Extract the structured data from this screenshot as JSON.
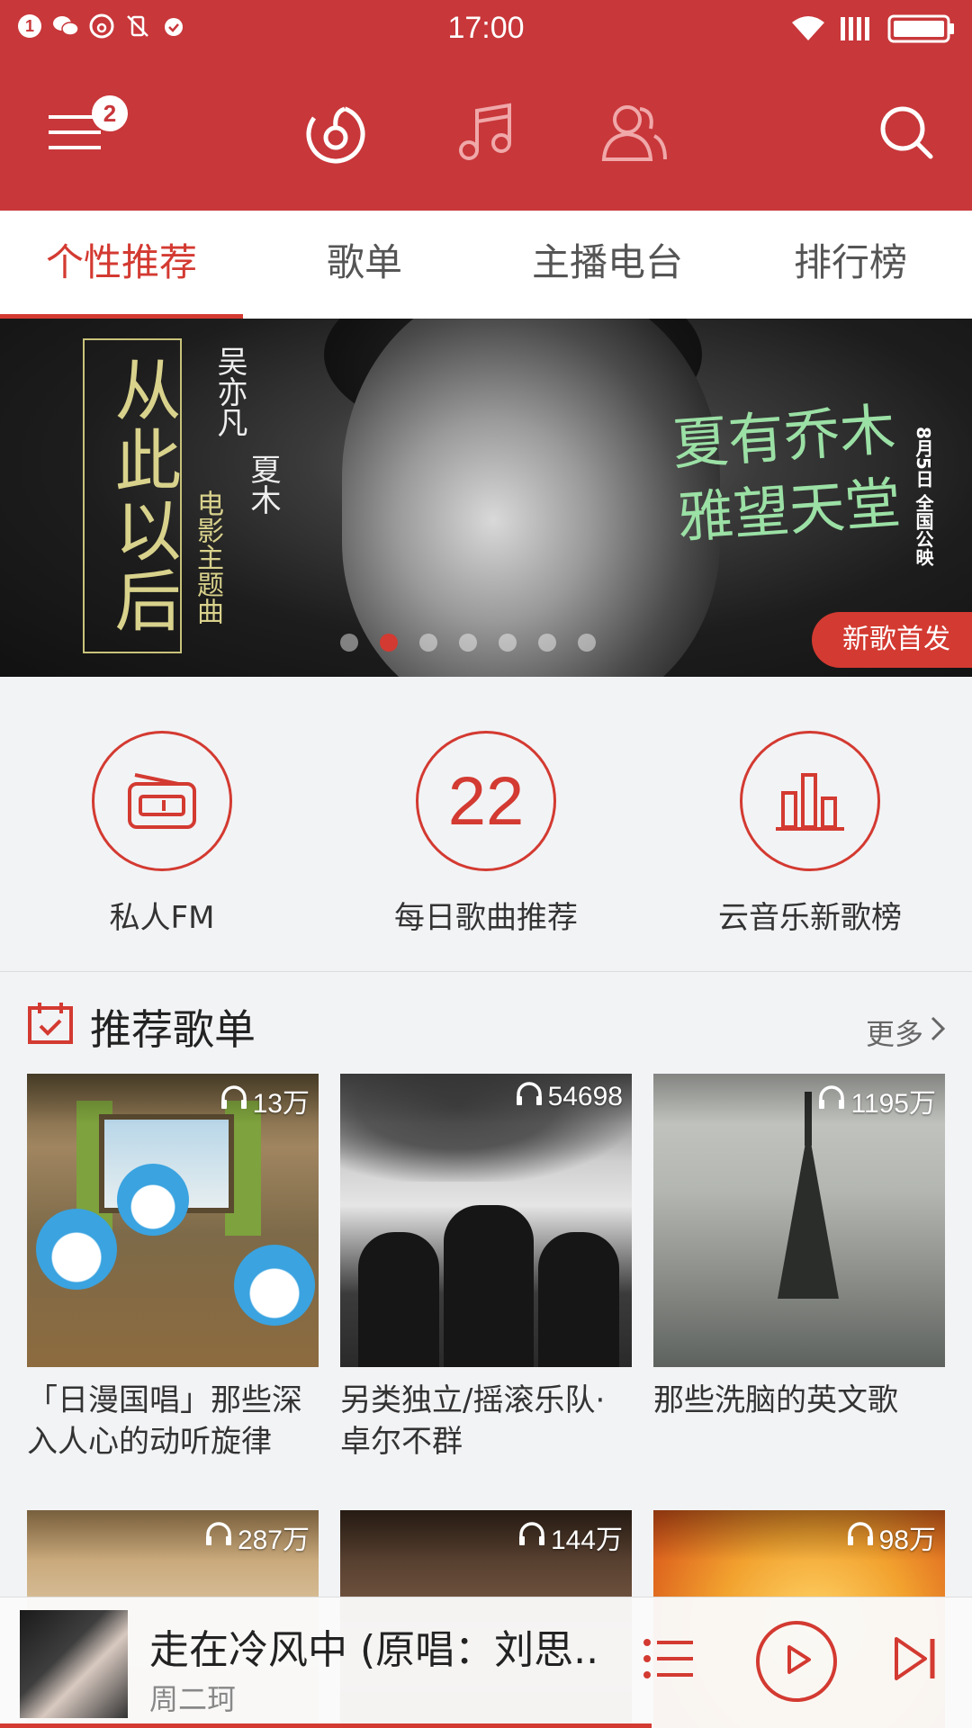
{
  "status_bar": {
    "time": "17:00",
    "notification_count": "1",
    "icons": [
      "notification-icon",
      "wechat-icon",
      "netease-music-icon",
      "vibrate-icon",
      "alarm-icon",
      "wifi-icon",
      "signal-icon",
      "battery-icon"
    ]
  },
  "top_bar": {
    "menu_badge": "2",
    "icons": [
      "menu-icon",
      "discover-icon",
      "my-music-icon",
      "friends-icon",
      "search-icon"
    ]
  },
  "tabs": [
    "个性推荐",
    "歌单",
    "主播电台",
    "排行榜"
  ],
  "banner": {
    "title_vertical": "从此以后",
    "singer": "吴亦凡",
    "song": "夏木",
    "subtitle": "电影主题曲",
    "film_title": "夏有乔木 雅望天堂",
    "release_date": "8月5日 全国公映",
    "tag": "新歌首发",
    "dot_count": 7,
    "active_dot": 1
  },
  "quick_entries": [
    {
      "label": "私人FM",
      "icon": "radio-icon"
    },
    {
      "label": "每日歌曲推荐",
      "icon": "calendar-day-icon",
      "number": "22"
    },
    {
      "label": "云音乐新歌榜",
      "icon": "chart-bars-icon"
    }
  ],
  "section": {
    "title": "推荐歌单",
    "more": "更多"
  },
  "playlists": [
    {
      "plays": "13万",
      "title": "「日漫国唱」那些深入人心的动听旋律"
    },
    {
      "plays": "54698",
      "title": "另类独立/摇滚乐队·卓尔不群"
    },
    {
      "plays": "1195万",
      "title": "那些洗脑的英文歌"
    },
    {
      "plays": "287万",
      "title": ""
    },
    {
      "plays": "144万",
      "title": ""
    },
    {
      "plays": "98万",
      "title": ""
    }
  ],
  "player": {
    "song": "走在冷风中 (原唱：刘思..",
    "artist": "周二珂",
    "state": "paused",
    "progress": 0.67
  },
  "colors": {
    "brand_red": "#c8373a",
    "accent_red": "#d33a31"
  }
}
